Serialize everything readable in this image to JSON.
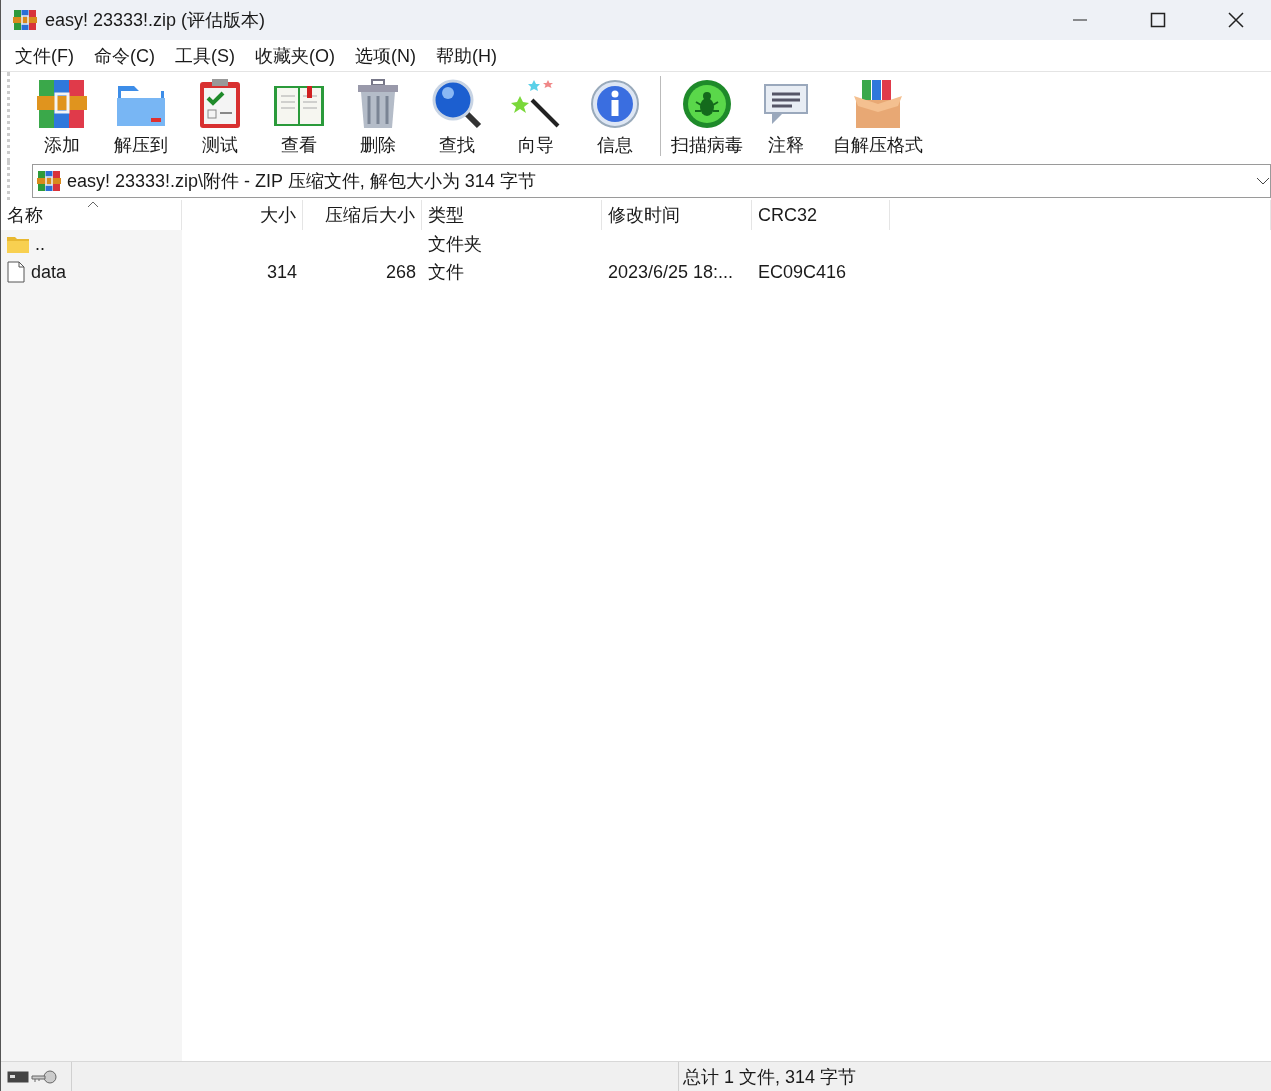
{
  "window": {
    "title": "easy! 23333!.zip (评估版本)"
  },
  "menu": [
    "文件(F)",
    "命令(C)",
    "工具(S)",
    "收藏夹(O)",
    "选项(N)",
    "帮助(H)"
  ],
  "toolbar_groups": [
    [
      {
        "kind": "add",
        "label": "添加"
      },
      {
        "kind": "extract",
        "label": "解压到"
      },
      {
        "kind": "test",
        "label": "测试"
      },
      {
        "kind": "view",
        "label": "查看"
      },
      {
        "kind": "delete",
        "label": "删除"
      },
      {
        "kind": "find",
        "label": "查找"
      },
      {
        "kind": "wizard",
        "label": "向导"
      },
      {
        "kind": "info",
        "label": "信息"
      }
    ],
    [
      {
        "kind": "scan",
        "label": "扫描病毒"
      },
      {
        "kind": "comment",
        "label": "注释"
      },
      {
        "kind": "sfx",
        "label": "自解压格式"
      }
    ]
  ],
  "path": "easy! 23333!.zip\\附件 - ZIP 压缩文件, 解包大小为 314 字节",
  "table": {
    "columns": [
      "名称",
      "大小",
      "压缩后大小",
      "类型",
      "修改时间",
      "CRC32"
    ],
    "rows": [
      {
        "kind": "folder",
        "name": "..",
        "size": "",
        "packed": "",
        "type": "文件夹",
        "modified": "",
        "crc": ""
      },
      {
        "kind": "file",
        "name": "data",
        "size": "314",
        "packed": "268",
        "type": "文件",
        "modified": "2023/6/25 18:...",
        "crc": "EC09C416"
      }
    ]
  },
  "status_bar": {
    "summary": "总计 1 文件, 314 字节"
  }
}
